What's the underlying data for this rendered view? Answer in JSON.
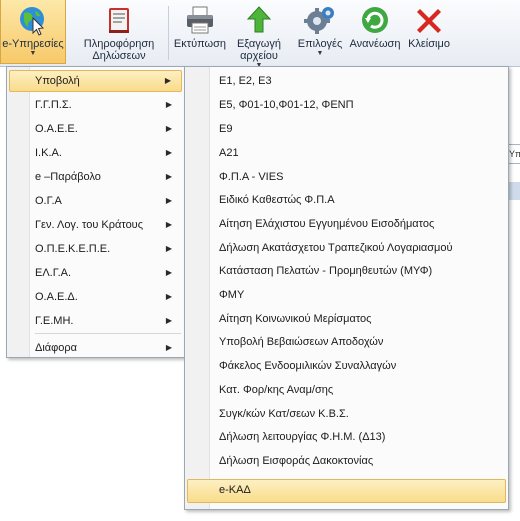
{
  "ribbon": {
    "buttons": [
      {
        "label": "e-Υπηρεσίες",
        "icon": "globe-cursor-icon",
        "dropdown": true
      },
      {
        "label": "Πληροφόρηση",
        "label2": "Δηλώσεων",
        "icon": "book-info-icon"
      },
      {
        "label": "Εκτύπωση",
        "icon": "printer-icon"
      },
      {
        "label": "Εξαγωγή",
        "label2": "αρχείου",
        "icon": "export-arrow-icon",
        "dropdown": true
      },
      {
        "label": "Επιλογές",
        "icon": "gears-icon",
        "dropdown": true
      },
      {
        "label": "Ανανέωση",
        "icon": "refresh-icon"
      },
      {
        "label": "Κλείσιμο",
        "icon": "close-x-icon"
      }
    ]
  },
  "menu_level1": {
    "items": [
      {
        "label": "Υποβολή",
        "has_submenu": true,
        "highlighted": true
      },
      {
        "label": "Γ.Γ.Π.Σ.",
        "has_submenu": true
      },
      {
        "label": "Ο.Α.Ε.Ε.",
        "has_submenu": true
      },
      {
        "label": "Ι.Κ.Α.",
        "has_submenu": true
      },
      {
        "label": "e –Παράβολο",
        "has_submenu": true
      },
      {
        "label": "Ο.Γ.Α",
        "has_submenu": true
      },
      {
        "label": "Γεν. Λογ. του Κράτους",
        "has_submenu": true
      },
      {
        "label": "Ο.Π.Ε.Κ.Ε.Π.Ε.",
        "has_submenu": true
      },
      {
        "label": "ΕΛ.Γ.Α.",
        "has_submenu": true
      },
      {
        "label": "Ο.Α.Ε.Δ.",
        "has_submenu": true
      },
      {
        "label": "Γ.Ε.ΜΗ.",
        "has_submenu": true
      },
      {
        "label": "Διάφορα",
        "has_submenu": true
      }
    ]
  },
  "menu_level2": {
    "items": [
      {
        "label": "Ε1, Ε2, Ε3"
      },
      {
        "label": "Ε5, Φ01-10,Φ01-12, ΦΕΝΠ"
      },
      {
        "label": "Ε9"
      },
      {
        "label": "Α21"
      },
      {
        "label": "Φ.Π.Α - VIES"
      },
      {
        "label": "Ειδικό Καθεστώς Φ.Π.Α"
      },
      {
        "label": "Αίτηση Ελάχιστου Εγγυημένου Εισοδήματος"
      },
      {
        "label": "Δήλωση Ακατάσχετου Τραπεζικού Λογαριασμού"
      },
      {
        "label": "Κατάσταση Πελατών - Προμηθευτών (ΜΥΦ)"
      },
      {
        "label": "ΦΜΥ"
      },
      {
        "label": "Αίτηση Κοινωνικού Μερίσματος"
      },
      {
        "label": "Υποβολή Βεβαιώσεων Αποδοχών"
      },
      {
        "label": "Φάκελος Ενδοομιλικών Συναλλαγών"
      },
      {
        "label": "Κατ. Φορ/κης Αναμ/σης"
      },
      {
        "label": "Συγκ/κών Κατ/σεων Κ.Β.Σ."
      },
      {
        "label": "Δήλωση λειτουργίας Φ.Η.Μ. (Δ13)"
      },
      {
        "label": "Δήλωση Εισφοράς Δακοκτονίας"
      },
      {
        "label": "e-ΚΑΔ",
        "highlighted": true
      }
    ]
  },
  "background": {
    "partial_text": "Υπ"
  },
  "colors": {
    "highlight_top": "#fdf0c2",
    "highlight_bottom": "#f9dc8b",
    "highlight_border": "#e2b85a",
    "menu_border": "#9da7b3"
  }
}
